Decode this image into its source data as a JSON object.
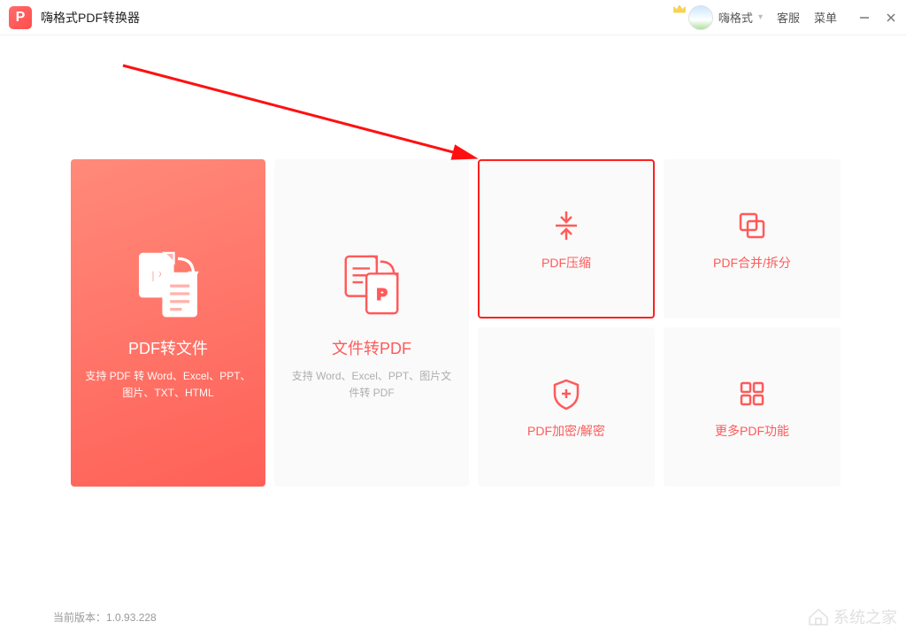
{
  "app": {
    "logo_letter": "P",
    "title": "嗨格式PDF转换器"
  },
  "header": {
    "user_name": "嗨格式",
    "support": "客服",
    "menu": "菜单"
  },
  "cards": {
    "pdf_to_file": {
      "title": "PDF转文件",
      "desc": "支持 PDF 转 Word、Excel、PPT、图片、TXT、HTML"
    },
    "file_to_pdf": {
      "title": "文件转PDF",
      "desc": "支持 Word、Excel、PPT、图片文件转 PDF"
    },
    "compress": {
      "title": "PDF压缩"
    },
    "merge_split": {
      "title": "PDF合并/拆分"
    },
    "encrypt": {
      "title": "PDF加密/解密"
    },
    "more": {
      "title": "更多PDF功能"
    }
  },
  "footer": {
    "version_label": "当前版本：",
    "version": "1.0.93.228"
  },
  "watermark": {
    "text": "系统之家"
  }
}
